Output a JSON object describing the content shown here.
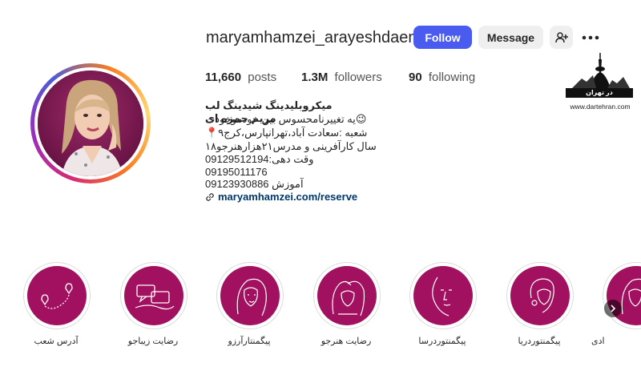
{
  "profile": {
    "username": "maryamhamzei_arayeshdaem",
    "follow_label": "Follow",
    "message_label": "Message",
    "posts_count": "11,660",
    "posts_label": "posts",
    "followers_count": "1.3M",
    "followers_label": "followers",
    "following_count": "90",
    "following_label": "following"
  },
  "bio": {
    "name": "میکروبلیدینگ شیدینگ لب مریم حمزه ای",
    "lines": [
      "یه تغییرنامحسوس بین خودموخودت😉",
      "📍۹شعبه :سعادت آباد،تهرانپارس،کرج",
      "۱۸سال کارآفرینی و مدرس۲۱هزارهنرجو",
      "وقت دهی:09129512194",
      "09195011176",
      "09123930886 آموزش"
    ],
    "link": "maryamhamzei.com/reserve"
  },
  "watermark": {
    "brand": "در تهران",
    "url": "www.dartehran.com"
  },
  "highlights": [
    {
      "label": "آدرس شعب",
      "icon": "map-route-icon"
    },
    {
      "label": "رضایت زیباجو",
      "icon": "chat-bubbles-icon"
    },
    {
      "label": "پیگمنتارآرزو",
      "icon": "woman-face-icon"
    },
    {
      "label": "رضایت هنرجو",
      "icon": "women-group-icon"
    },
    {
      "label": "پیگمنتوردرسا",
      "icon": "face-lineart-icon"
    },
    {
      "label": "پیگمنتوردریا",
      "icon": "woman-profile-icon"
    },
    {
      "label": "ادی",
      "icon": "woman-face-icon"
    }
  ],
  "colors": {
    "follow_button": "#4a5cf0",
    "highlight_bg": "#a2115f",
    "link": "#00376b"
  }
}
